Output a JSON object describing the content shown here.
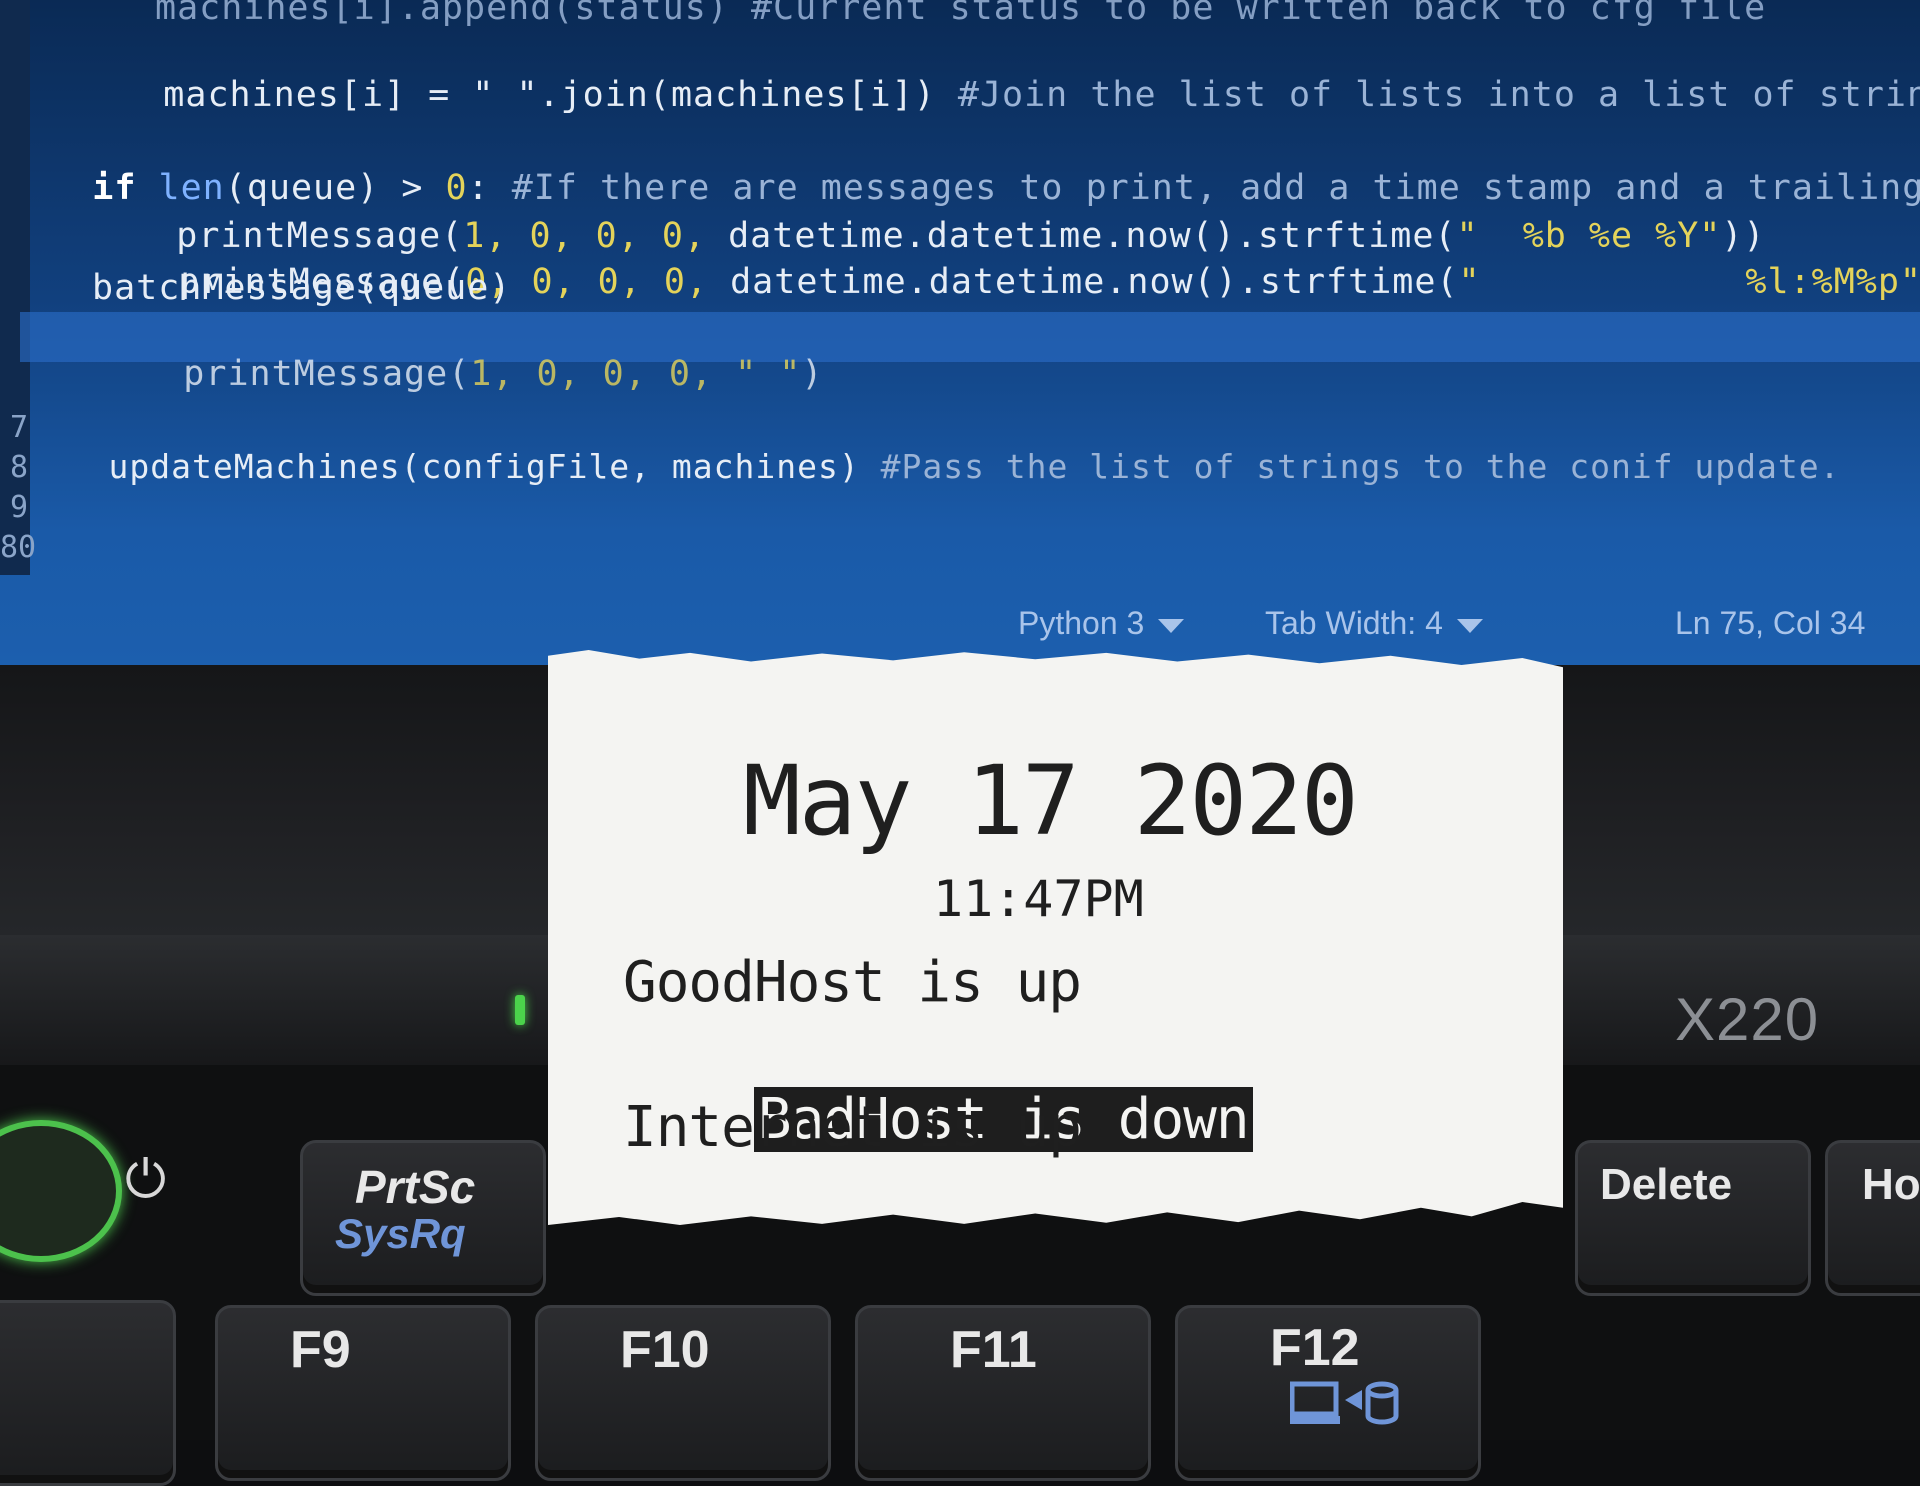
{
  "editor": {
    "line_numbers": [
      "7",
      "8",
      "9",
      "80"
    ],
    "code": {
      "l1": {
        "text": "machines[i].append(status) #Current status to be written back to cfg file"
      },
      "l2": {
        "pre": "machines[i] = \" \".join(machines[i]) ",
        "comment": "#Join the list of lists into a list of string with wh"
      },
      "l3": {
        "kw": "if",
        "fn": "len",
        "rest": "(queue) > ",
        "num": "0",
        "colon": ": ",
        "comment": "#If there are messages to print, add a time stamp and a trailing white line"
      },
      "l4": {
        "fn": "printMessage(",
        "args": "1, 0, 0, 0, ",
        "call": "datetime.datetime.now().strftime(",
        "str": "\"  %b %e %Y\"",
        "end": "))"
      },
      "l5": {
        "fn": "printMessage(",
        "args": "0, 0, 0, 0, ",
        "call": "datetime.datetime.now().strftime(",
        "str": "\"            %l:%M%p\"",
        "end": "))"
      },
      "l6": {
        "text": "batchMessage(queue)"
      },
      "l7": {
        "fn": "printMessage(",
        "args": "1, 0, 0, 0, ",
        "str": "\" \"",
        "end": ")"
      },
      "l8": {
        "pre": "updateMachines(configFile, machines) ",
        "comment": "#Pass the list of strings to the conif update."
      }
    },
    "status_bar": {
      "language": "Python 3",
      "tab_width": "Tab Width: 4",
      "cursor": "Ln 75, Col 34"
    }
  },
  "laptop": {
    "model": "X220"
  },
  "keyboard": {
    "prtsc": "PrtSc",
    "sysrq": "SysRq",
    "delete": "Delete",
    "home": "Ho",
    "f9": "F9",
    "f10": "F10",
    "f11": "F11",
    "f12": "F12",
    "power_icon": "power-icon"
  },
  "receipt": {
    "date": "May 17 2020",
    "time": "11:47PM",
    "lines": [
      "GoodHost is up",
      "BadHost is down",
      "Internet is up"
    ]
  },
  "colors": {
    "editor_bg": "#11407e",
    "receipt_paper": "#f4f4f2",
    "power_led": "#4cc14c"
  }
}
